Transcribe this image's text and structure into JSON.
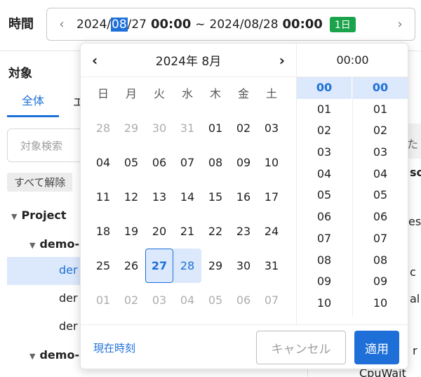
{
  "header": {
    "time_label": "時間",
    "prev": "‹",
    "next": "›",
    "range": {
      "start_year": "2024/",
      "start_month": "08",
      "start_day": "/27",
      "start_time": "00:00",
      "separator": "~",
      "end_date": "2024/08/28",
      "end_time": "00:00",
      "duration_badge": "1日"
    }
  },
  "left_panel": {
    "title": "対象",
    "tabs": [
      {
        "label": "全体"
      },
      {
        "label": "エ"
      }
    ],
    "search_placeholder": "対象検索",
    "clear_all": "すべて解除",
    "tree": [
      {
        "label": "Project"
      },
      {
        "label": "demo-"
      },
      {
        "label": "der"
      },
      {
        "label": "der"
      },
      {
        "label": "der"
      },
      {
        "label": "demo-"
      }
    ]
  },
  "right_fragments": [
    "た",
    "sc",
    "es",
    "c",
    "al",
    "r",
    "CpuWait"
  ],
  "calendar": {
    "prev_label": "‹",
    "next_label": "›",
    "month_label": "2024年 8月",
    "weekdays": [
      "日",
      "月",
      "火",
      "水",
      "木",
      "金",
      "土"
    ],
    "days": [
      {
        "d": "28",
        "out": true
      },
      {
        "d": "29",
        "out": true
      },
      {
        "d": "30",
        "out": true
      },
      {
        "d": "31",
        "out": true
      },
      {
        "d": "01"
      },
      {
        "d": "02"
      },
      {
        "d": "03"
      },
      {
        "d": "04"
      },
      {
        "d": "05"
      },
      {
        "d": "06"
      },
      {
        "d": "07"
      },
      {
        "d": "08"
      },
      {
        "d": "09"
      },
      {
        "d": "10"
      },
      {
        "d": "11"
      },
      {
        "d": "12"
      },
      {
        "d": "13"
      },
      {
        "d": "14"
      },
      {
        "d": "15"
      },
      {
        "d": "16"
      },
      {
        "d": "17"
      },
      {
        "d": "18"
      },
      {
        "d": "19"
      },
      {
        "d": "20"
      },
      {
        "d": "21"
      },
      {
        "d": "22"
      },
      {
        "d": "23"
      },
      {
        "d": "24"
      },
      {
        "d": "25"
      },
      {
        "d": "26"
      },
      {
        "d": "27",
        "state": "start"
      },
      {
        "d": "28",
        "state": "end"
      },
      {
        "d": "29"
      },
      {
        "d": "30"
      },
      {
        "d": "31"
      },
      {
        "d": "01",
        "out": true
      },
      {
        "d": "02",
        "out": true
      },
      {
        "d": "03",
        "out": true
      },
      {
        "d": "04",
        "out": true
      },
      {
        "d": "05",
        "out": true
      },
      {
        "d": "06",
        "out": true
      },
      {
        "d": "07",
        "out": true
      }
    ]
  },
  "time_picker": {
    "header": "00:00",
    "hours": [
      "00",
      "01",
      "02",
      "03",
      "04",
      "05",
      "06",
      "07",
      "08",
      "09",
      "10"
    ],
    "minutes": [
      "00",
      "01",
      "02",
      "03",
      "04",
      "05",
      "06",
      "07",
      "08",
      "09",
      "10"
    ],
    "selected_hour": "00",
    "selected_minute": "00"
  },
  "footer": {
    "now_label": "現在時刻",
    "cancel_label": "キャンセル",
    "apply_label": "適用"
  },
  "colors": {
    "accent": "#1e70d8",
    "badge_green": "#1aa34a",
    "range_highlight": "#dce8fb"
  }
}
